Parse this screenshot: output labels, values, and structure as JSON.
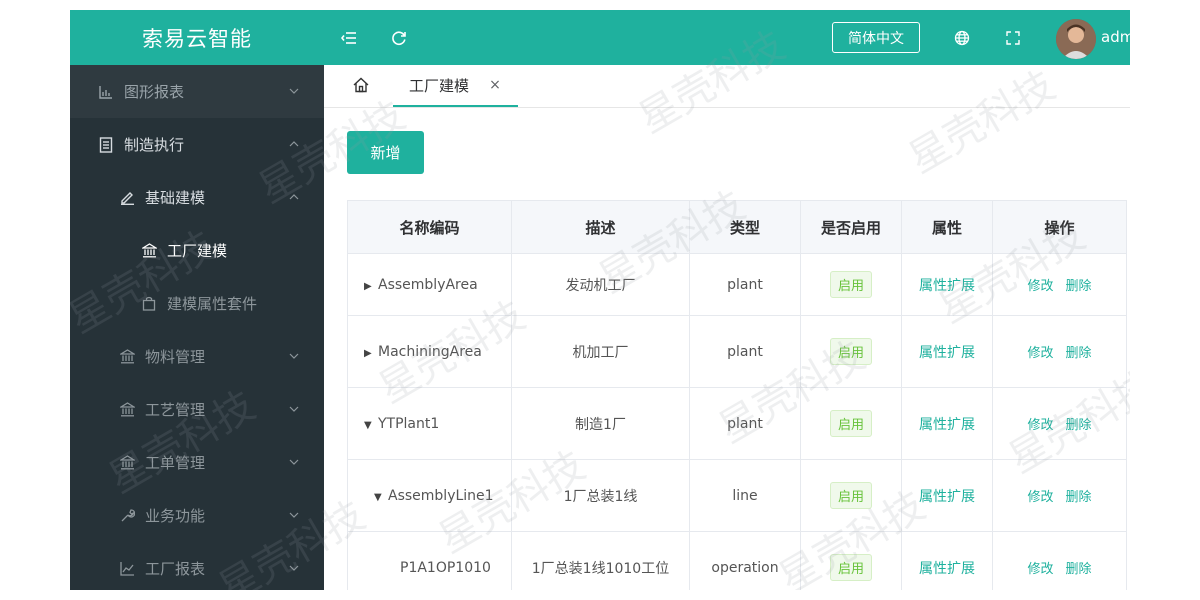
{
  "header": {
    "app_title": "索易云智能",
    "lang_button": "简体中文",
    "user_name": "adm",
    "icons": [
      "menu-fold-icon",
      "refresh-icon",
      "globe-icon",
      "fullscreen-icon"
    ]
  },
  "sidebar": {
    "items": [
      {
        "label": "图形报表",
        "icon": "bar-chart-icon"
      },
      {
        "label": "制造执行",
        "icon": "document-icon"
      },
      {
        "label": "基础建模",
        "icon": "edit-icon"
      },
      {
        "label": "工厂建模",
        "icon": "bank-icon"
      },
      {
        "label": "建模属性套件",
        "icon": "bag-icon"
      },
      {
        "label": "物料管理",
        "icon": "bank-icon"
      },
      {
        "label": "工艺管理",
        "icon": "bank-icon"
      },
      {
        "label": "工单管理",
        "icon": "bank-icon"
      },
      {
        "label": "业务功能",
        "icon": "wrench-icon"
      },
      {
        "label": "工厂报表",
        "icon": "line-chart-icon"
      }
    ]
  },
  "tabs": {
    "active_label": "工厂建模",
    "close_symbol": "×"
  },
  "toolbar": {
    "add_label": "新增"
  },
  "table": {
    "columns": [
      "名称编码",
      "描述",
      "类型",
      "是否启用",
      "属性",
      "操作"
    ],
    "rows": [
      {
        "name": "AssemblyArea",
        "desc": "发动机工厂",
        "type": "plant",
        "enabled": "启用",
        "attr": "属性扩展",
        "edit": "修改",
        "delete": "删除",
        "arrow": "▶"
      },
      {
        "name": "MachiningArea",
        "desc": "机加工厂",
        "type": "plant",
        "enabled": "启用",
        "attr": "属性扩展",
        "edit": "修改",
        "delete": "删除",
        "arrow": "▶"
      },
      {
        "name": "YTPlant1",
        "desc": "制造1厂",
        "type": "plant",
        "enabled": "启用",
        "attr": "属性扩展",
        "edit": "修改",
        "delete": "删除",
        "arrow": "▼"
      },
      {
        "name": "AssemblyLine1",
        "desc": "1厂总装1线",
        "type": "line",
        "enabled": "启用",
        "attr": "属性扩展",
        "edit": "修改",
        "delete": "删除",
        "arrow": "▼"
      },
      {
        "name": "P1A1OP1010",
        "desc": "1厂总装1线1010工位",
        "type": "operation",
        "enabled": "启用",
        "attr": "属性扩展",
        "edit": "修改",
        "delete": "删除",
        "arrow": ""
      }
    ]
  },
  "watermark": {
    "text": "星壳科技"
  },
  "colors": {
    "accent": "#1fb19e",
    "sidebar_bg": "#263238",
    "tag_green": "#67c23a"
  }
}
